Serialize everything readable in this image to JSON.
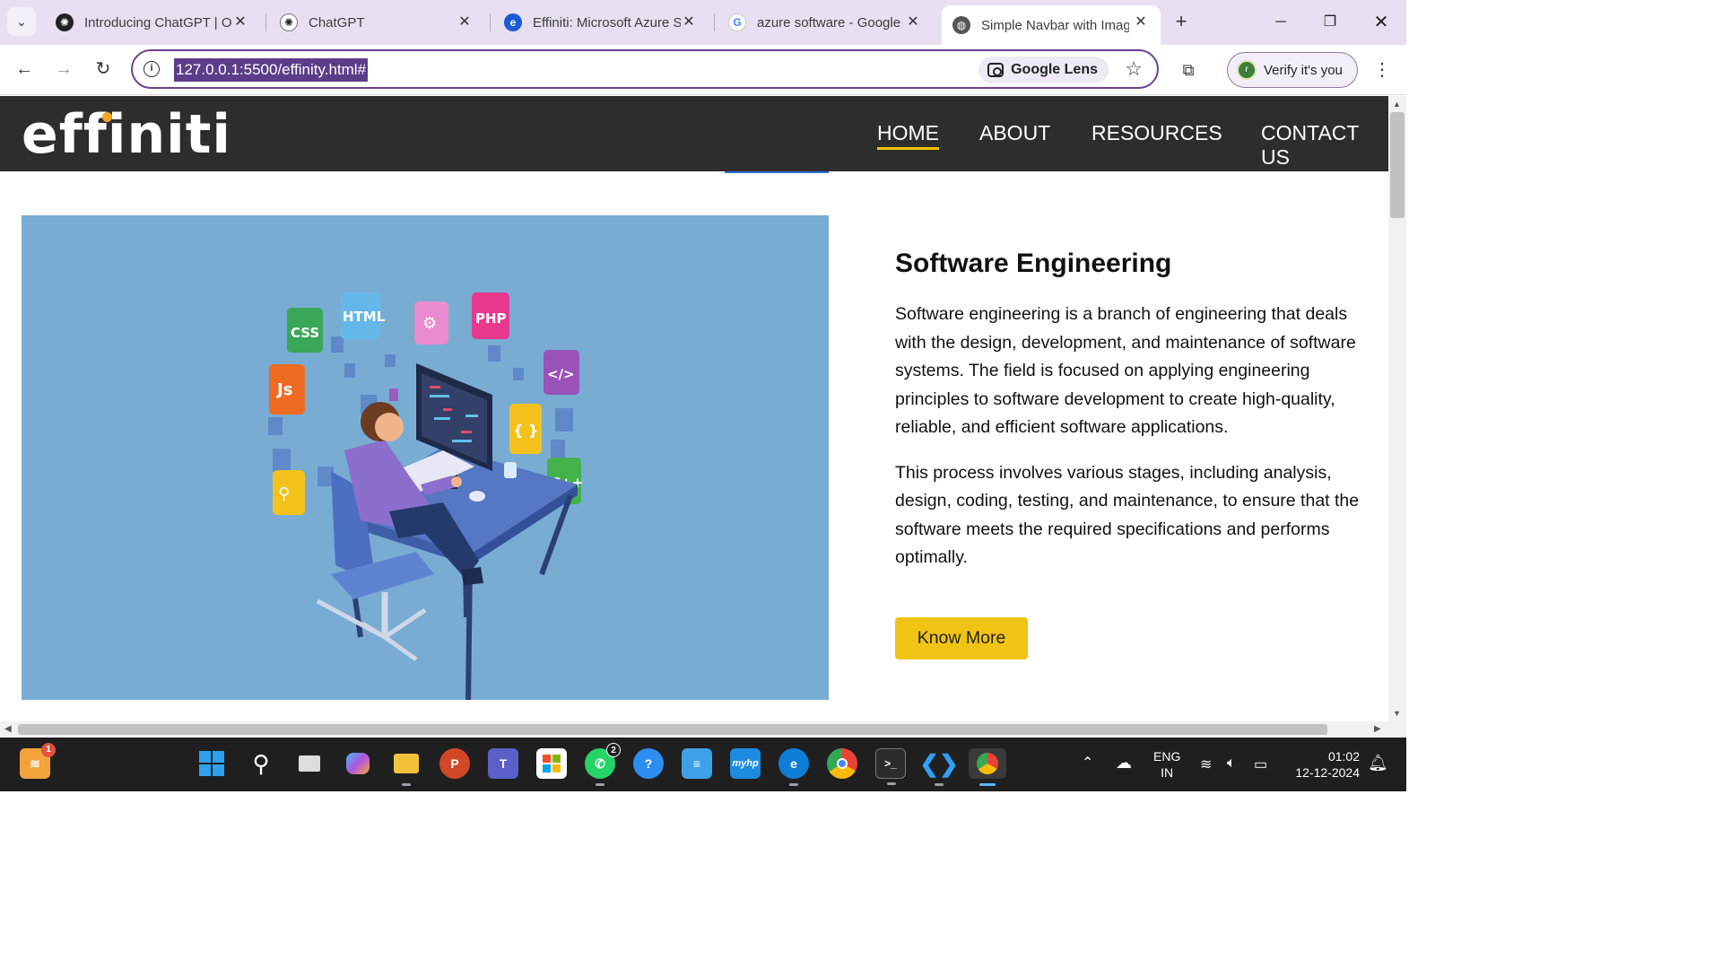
{
  "browser": {
    "tabs": [
      {
        "title": "Introducing ChatGPT | Op",
        "icon": "openai-icon",
        "active": false
      },
      {
        "title": "ChatGPT",
        "icon": "openai-icon",
        "active": false
      },
      {
        "title": "Effiniti: Microsoft Azure S",
        "icon": "effiniti-icon",
        "active": false
      },
      {
        "title": "azure software - Google S",
        "icon": "google-icon",
        "active": false
      },
      {
        "title": "Simple Navbar with Imag",
        "icon": "globe-icon",
        "active": true
      }
    ],
    "address": "127.0.0.1:5500/effinity.html#",
    "lens_label": "Google Lens",
    "verify_label": "Verify it's you",
    "profile_initial": "r"
  },
  "site": {
    "logo": "effiniti",
    "nav": [
      {
        "label": "HOME",
        "active": true
      },
      {
        "label": "ABOUT",
        "active": false
      },
      {
        "label": "RESOURCES",
        "active": false
      },
      {
        "label": "CONTACT US",
        "active": false
      }
    ],
    "section": {
      "heading": "Software Engineering",
      "paragraph1": "Software engineering is a branch of engineering that deals with the design, development, and maintenance of software systems. The field is focused on applying engineering principles to software development to create high-quality, reliable, and efficient software applications.",
      "paragraph2": "This process involves various stages, including analysis, design, coding, testing, and maintenance, to ensure that the software meets the required specifications and performs optimally.",
      "button": "Know More",
      "illustration_tiles": [
        "CSS",
        "HTML",
        "PHP",
        "Js",
        "C++",
        "</>",
        "{ }"
      ]
    },
    "colors": {
      "navbar": "#2d2d2d",
      "accent": "#f0c414",
      "hero_bg": "#78acd3"
    }
  },
  "taskbar": {
    "weather_badge": "1",
    "whatsapp_badge": "2",
    "lang": "ENG",
    "region": "IN",
    "time": "01:02",
    "date": "12-12-2024"
  }
}
